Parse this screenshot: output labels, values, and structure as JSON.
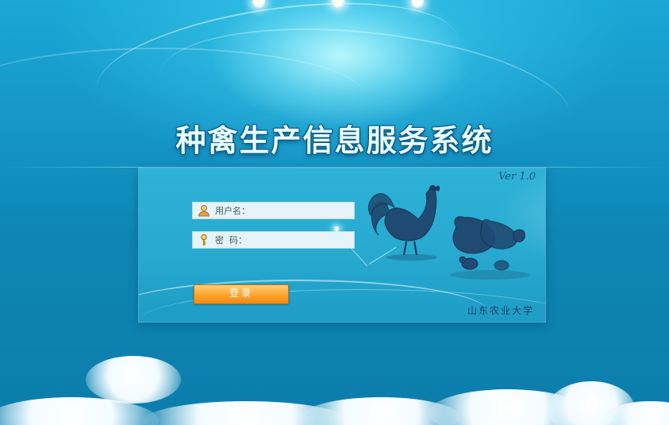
{
  "app": {
    "title": "种禽生产信息服务系统",
    "version": "Ver 1.0",
    "institution": "山东农业大学"
  },
  "login": {
    "username_label": "用户名：",
    "username_value": "",
    "password_label": "密  码：",
    "password_value": "",
    "submit_label": "登录"
  },
  "icons": {
    "username": "user-icon",
    "password": "key-icon"
  },
  "colors": {
    "background": "#1596c6",
    "panel": "#2eb2d8",
    "button": "#ffa531",
    "title": "#eaffff"
  }
}
